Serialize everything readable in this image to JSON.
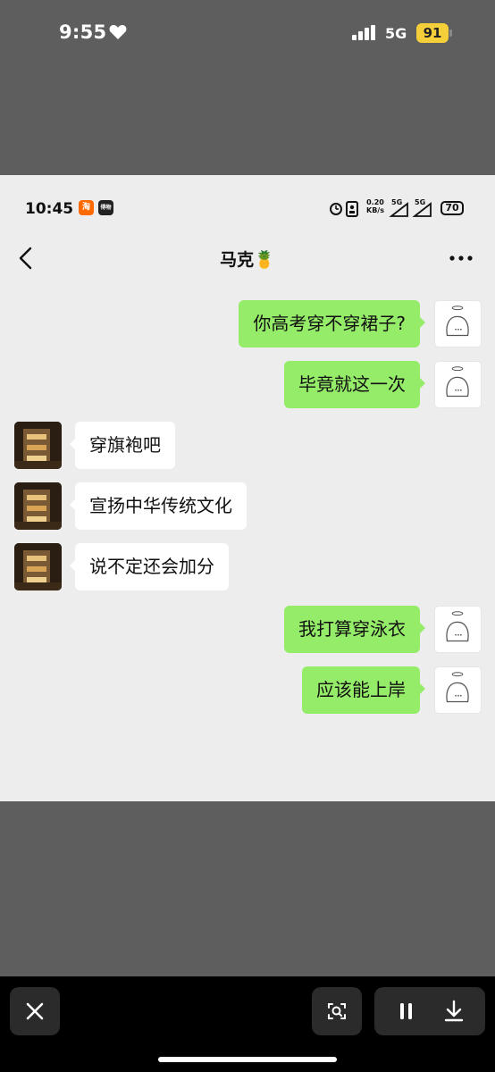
{
  "outer_status": {
    "time": "9:55",
    "network": "5G",
    "battery": "91",
    "icons": [
      "heart-icon",
      "signal-icon"
    ]
  },
  "screenshot": {
    "status_bar": {
      "time": "10:45",
      "app_badges": [
        "淘",
        "得物"
      ],
      "speed_value": "0.20",
      "speed_unit": "KB/s",
      "network": "5G",
      "battery": "70"
    },
    "header": {
      "title": "马克🍍",
      "back_icon": "chevron-left-icon",
      "more_icon": "more-horizontal-icon"
    },
    "messages": [
      {
        "sender": "me",
        "text": "你高考穿不穿裙子?"
      },
      {
        "sender": "me",
        "text": "毕竟就这一次"
      },
      {
        "sender": "other",
        "text": "穿旗袍吧"
      },
      {
        "sender": "other",
        "text": "宣扬中华传统文化"
      },
      {
        "sender": "other",
        "text": "说不定还会加分"
      },
      {
        "sender": "me",
        "text": "我打算穿泳衣"
      },
      {
        "sender": "me",
        "text": "应该能上岸"
      }
    ]
  },
  "toolbar": {
    "buttons": [
      "close-icon",
      "screenshot-scan-icon",
      "pause-icon",
      "download-icon"
    ]
  },
  "colors": {
    "outer_background": "#5e5e5e",
    "chat_background": "#ededed",
    "my_bubble": "#95ec69",
    "other_bubble": "#ffffff",
    "battery_accent": "#f4cf3a",
    "toolbar": "#000000"
  }
}
